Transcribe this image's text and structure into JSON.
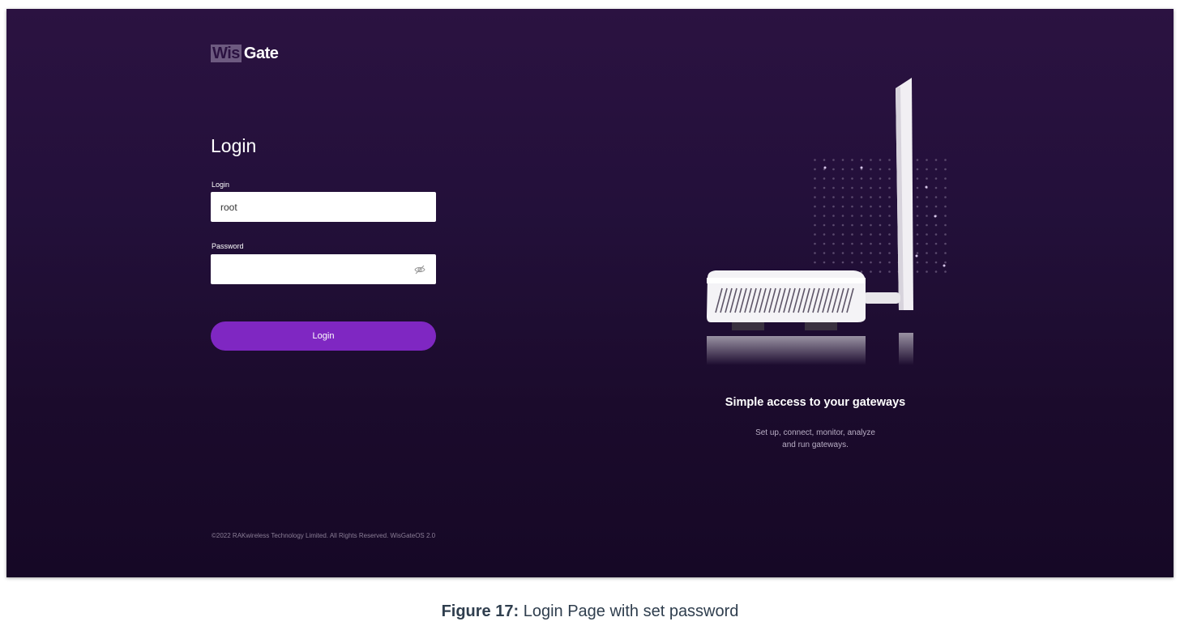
{
  "logo": {
    "part1": "Wis",
    "part2": "Gate"
  },
  "login_form": {
    "title": "Login",
    "username_label": "Login",
    "username_value": "root",
    "password_label": "Password",
    "password_value": "",
    "submit_label": "Login"
  },
  "hero": {
    "tagline": "Simple access to your gateways",
    "subtext_line1": "Set up, connect, monitor, analyze",
    "subtext_line2": "and run gateways."
  },
  "footer": {
    "copyright": "©2022 RAKwireless Technology Limited. All Rights Reserved. WisGateOS 2.0"
  },
  "caption": {
    "label": "Figure 17:",
    "text": " Login Page with set password"
  },
  "colors": {
    "background": "#23103a",
    "accent_button": "#7f27c2",
    "input_background": "#ffffff"
  },
  "icons": {
    "password_toggle": "eye-slash-icon"
  }
}
